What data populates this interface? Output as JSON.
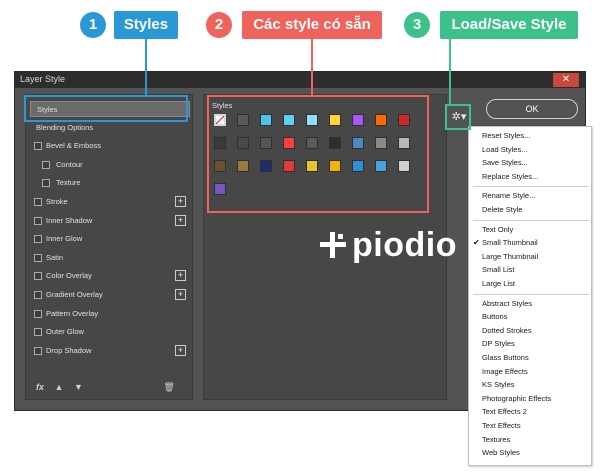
{
  "callouts": [
    {
      "num": "1",
      "label": "Styles"
    },
    {
      "num": "2",
      "label": "Các style có sẵn"
    },
    {
      "num": "3",
      "label": "Load/Save Style"
    }
  ],
  "dialog": {
    "title": "Layer Style",
    "close_glyph": "✕",
    "ok_label": "OK",
    "styles_label": "Styles",
    "fx_label": "fx",
    "gear_glyph": "✲▾"
  },
  "left_panel": {
    "items": [
      {
        "label": "Styles",
        "selected": true,
        "checkbox": false,
        "plus": false
      },
      {
        "label": "Blending Options",
        "selected": false,
        "checkbox": false,
        "plus": false
      },
      {
        "label": "Bevel & Emboss",
        "selected": false,
        "checkbox": true,
        "plus": false
      },
      {
        "label": "Contour",
        "selected": false,
        "checkbox": true,
        "plus": false
      },
      {
        "label": "Texture",
        "selected": false,
        "checkbox": true,
        "plus": false
      },
      {
        "label": "Stroke",
        "selected": false,
        "checkbox": true,
        "plus": true
      },
      {
        "label": "Inner Shadow",
        "selected": false,
        "checkbox": true,
        "plus": true
      },
      {
        "label": "Inner Glow",
        "selected": false,
        "checkbox": true,
        "plus": false
      },
      {
        "label": "Satin",
        "selected": false,
        "checkbox": true,
        "plus": false
      },
      {
        "label": "Color Overlay",
        "selected": false,
        "checkbox": true,
        "plus": true
      },
      {
        "label": "Gradient Overlay",
        "selected": false,
        "checkbox": true,
        "plus": true
      },
      {
        "label": "Pattern Overlay",
        "selected": false,
        "checkbox": true,
        "plus": false
      },
      {
        "label": "Outer Glow",
        "selected": false,
        "checkbox": true,
        "plus": false
      },
      {
        "label": "Drop Shadow",
        "selected": false,
        "checkbox": true,
        "plus": true
      }
    ]
  },
  "swatches": [
    [
      "#ffffff",
      "#5a5a5a",
      "#4ec3e8",
      "#5fd0f0",
      "#8fe0ff",
      "#ffd43a",
      "#a855f7",
      "#ff6a00",
      "#c9272d"
    ],
    [
      "#3a3a3a",
      "#4a4a4a",
      "#555555",
      "#ff3d3d",
      "#5a5a5a",
      "#2d2d2d",
      "#4d88c4",
      "#8a8a8a",
      "#b8b8b8"
    ],
    [
      "#6b5330",
      "#9a7a3a",
      "#1f2d6a",
      "#e03a3a",
      "#e8c42a",
      "#f2b400",
      "#2c8fd6",
      "#4ba0e0",
      "#cfcfcf"
    ],
    [
      "#7b54c4"
    ]
  ],
  "watermark": {
    "text": "piodio"
  },
  "menu": {
    "items": [
      {
        "label": "Reset Styles...",
        "check": false,
        "sep_after": false
      },
      {
        "label": "Load Styles...",
        "check": false,
        "sep_after": false
      },
      {
        "label": "Save Styles...",
        "check": false,
        "sep_after": false
      },
      {
        "label": "Replace Styles...",
        "check": false,
        "sep_after": true
      },
      {
        "label": "Rename Style...",
        "check": false,
        "sep_after": false
      },
      {
        "label": "Delete Style",
        "check": false,
        "sep_after": true
      },
      {
        "label": "Text Only",
        "check": false,
        "sep_after": false
      },
      {
        "label": "Small Thumbnail",
        "check": true,
        "sep_after": false
      },
      {
        "label": "Large Thumbnail",
        "check": false,
        "sep_after": false
      },
      {
        "label": "Small List",
        "check": false,
        "sep_after": false
      },
      {
        "label": "Large List",
        "check": false,
        "sep_after": true
      },
      {
        "label": "Abstract Styles",
        "check": false,
        "sep_after": false
      },
      {
        "label": "Buttons",
        "check": false,
        "sep_after": false
      },
      {
        "label": "Dotted Strokes",
        "check": false,
        "sep_after": false
      },
      {
        "label": "DP Styles",
        "check": false,
        "sep_after": false
      },
      {
        "label": "Glass Buttons",
        "check": false,
        "sep_after": false
      },
      {
        "label": "Image Effects",
        "check": false,
        "sep_after": false
      },
      {
        "label": "KS Styles",
        "check": false,
        "sep_after": false
      },
      {
        "label": "Photographic Effects",
        "check": false,
        "sep_after": false
      },
      {
        "label": "Text Effects 2",
        "check": false,
        "sep_after": false
      },
      {
        "label": "Text Effects",
        "check": false,
        "sep_after": false
      },
      {
        "label": "Textures",
        "check": false,
        "sep_after": false
      },
      {
        "label": "Web Styles",
        "check": false,
        "sep_after": false
      }
    ],
    "check_glyph": "✔"
  },
  "colors": {
    "callout_blue": "#2a97d6",
    "callout_red": "#f0625c",
    "callout_green": "#3cc289",
    "dialog_bg": "#535353"
  }
}
